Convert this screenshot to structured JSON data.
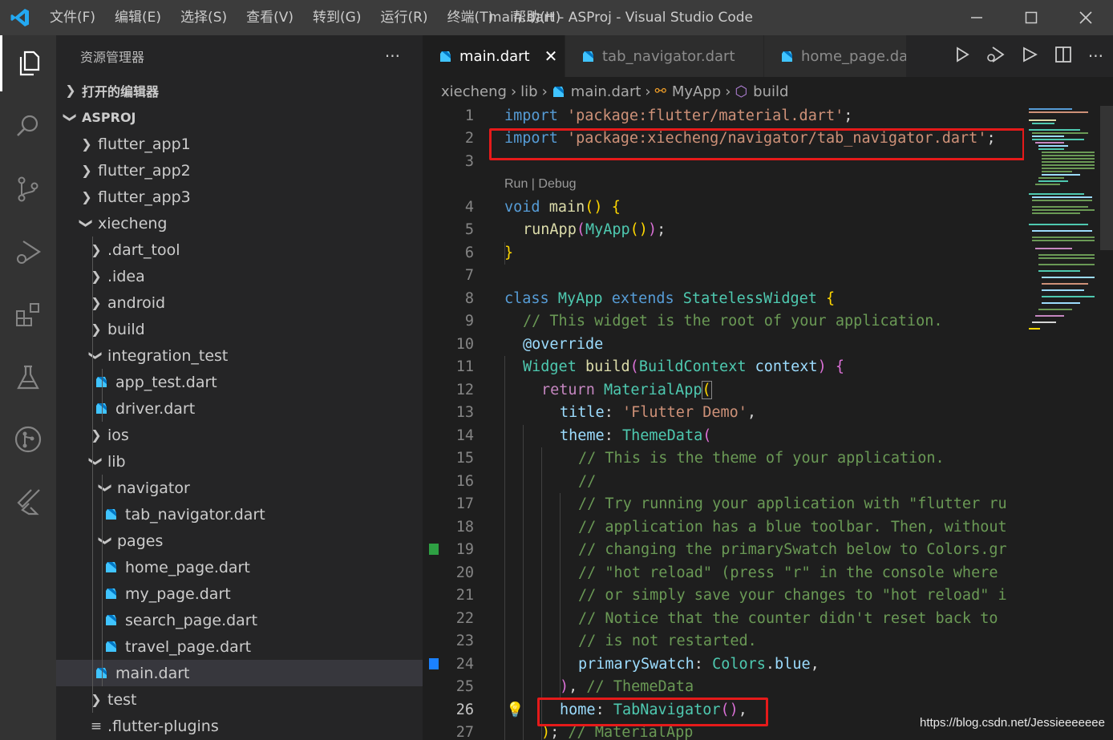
{
  "window": {
    "title": "main.dart - ASProj - Visual Studio Code"
  },
  "menu": [
    "文件(F)",
    "编辑(E)",
    "选择(S)",
    "查看(V)",
    "转到(G)",
    "运行(R)",
    "终端(T)",
    "帮助(H)"
  ],
  "activity_bar": [
    "explorer-icon",
    "search-icon",
    "source-control-icon",
    "run-debug-icon",
    "extensions-icon",
    "testing-icon",
    "gitlens-icon",
    "flutter-icon"
  ],
  "explorer": {
    "header": "资源管理器",
    "more": "···",
    "open_editors": "打开的编辑器",
    "root": "ASPROJ",
    "items": [
      "flutter_app1",
      "flutter_app2",
      "flutter_app3",
      "xiecheng",
      ".dart_tool",
      ".idea",
      "android",
      "build",
      "integration_test",
      "app_test.dart",
      "driver.dart",
      "ios",
      "lib",
      "navigator",
      "tab_navigator.dart",
      "pages",
      "home_page.dart",
      "my_page.dart",
      "search_page.dart",
      "travel_page.dart",
      "main.dart",
      "test",
      ".flutter-plugins"
    ]
  },
  "tabs": [
    "main.dart",
    "tab_navigator.dart",
    "home_page.da"
  ],
  "tab_close": "✕",
  "breadcrumb": [
    "xiecheng",
    "lib",
    "main.dart",
    "MyApp",
    "build"
  ],
  "code_lens": "Run | Debug",
  "line_numbers": [
    "1",
    "2",
    "3",
    "4",
    "5",
    "6",
    "7",
    "8",
    "9",
    "10",
    "11",
    "12",
    "13",
    "14",
    "15",
    "16",
    "17",
    "18",
    "19",
    "20",
    "21",
    "22",
    "23",
    "24",
    "25",
    "26",
    "27"
  ],
  "code": {
    "l1": [
      "import",
      " ",
      "'package:flutter/material.dart'",
      ";"
    ],
    "l2": [
      "import",
      " ",
      "'package:xiecheng/navigator/tab_navigator.dart'",
      ";"
    ],
    "l4": [
      "void",
      " ",
      "main",
      "()",
      " ",
      "{"
    ],
    "l5": [
      "runApp",
      "(",
      "MyApp",
      "()",
      ")",
      ";"
    ],
    "l6": [
      "}"
    ],
    "l8": [
      "class",
      " ",
      "MyApp",
      " ",
      "extends",
      " ",
      "StatelessWidget",
      " ",
      "{"
    ],
    "l9": [
      "// This widget is the root of your application."
    ],
    "l10": [
      "@override"
    ],
    "l11": [
      "Widget",
      " ",
      "build",
      "(",
      "BuildContext",
      " ",
      "context",
      ")",
      " ",
      "{"
    ],
    "l12": [
      "return",
      " ",
      "MaterialApp",
      "("
    ],
    "l13": [
      "title",
      ": ",
      "'Flutter Demo'",
      ","
    ],
    "l14": [
      "theme",
      ": ",
      "ThemeData",
      "("
    ],
    "l15": [
      "// This is the theme of your application."
    ],
    "l16": [
      "//"
    ],
    "l17": [
      "// Try running your application with \"flutter ru"
    ],
    "l18": [
      "// application has a blue toolbar. Then, without"
    ],
    "l19": [
      "// changing the primarySwatch below to Colors.gr"
    ],
    "l20": [
      "// \"hot reload\" (press \"r\" in the console where"
    ],
    "l21": [
      "// or simply save your changes to \"hot reload\" i"
    ],
    "l22": [
      "// Notice that the counter didn't reset back to"
    ],
    "l23": [
      "// is not restarted."
    ],
    "l24": [
      "primarySwatch",
      ": ",
      "Colors",
      ".",
      "blue",
      ","
    ],
    "l25": [
      ")",
      ", ",
      "// ThemeData"
    ],
    "l26": [
      "home",
      ": ",
      "TabNavigator",
      "()",
      ","
    ],
    "l27": [
      ")",
      "; ",
      "// MaterialApp"
    ]
  },
  "watermark": "https://blog.csdn.net/Jessieeeeeee",
  "colors": {
    "highlight_box": "#e51a1a",
    "accent": "#0078d4"
  }
}
